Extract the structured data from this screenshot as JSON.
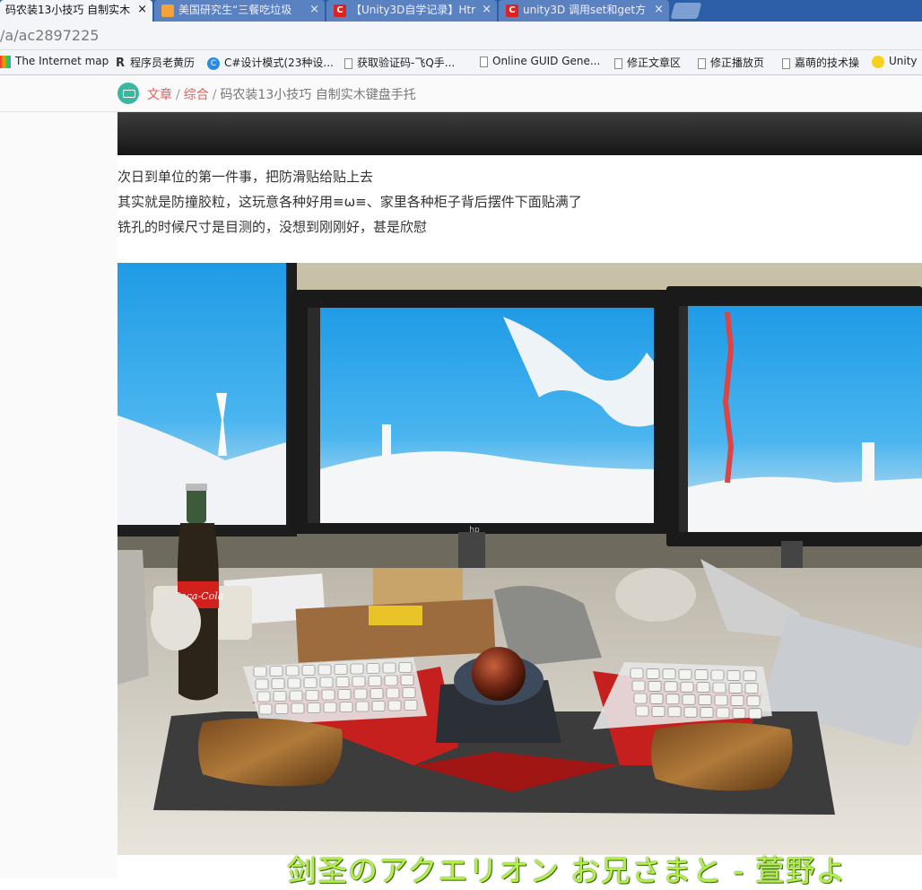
{
  "tabs": [
    {
      "title": "码农装13小技巧 自制实木",
      "active": true,
      "favicon": "red",
      "icon_char": ""
    },
    {
      "title": "美国研究生“三餐吃垃圾",
      "active": false,
      "favicon": "pic",
      "icon_char": ""
    },
    {
      "title": "【Unity3D自学记录】Htr",
      "active": false,
      "favicon": "red",
      "icon_char": "C"
    },
    {
      "title": "unity3D 调用set和get方",
      "active": false,
      "favicon": "red",
      "icon_char": "C"
    }
  ],
  "close_glyph": "×",
  "address": {
    "url": "/a/ac2897225"
  },
  "bookmarks": [
    {
      "label": "The Internet map",
      "icon": "map"
    },
    {
      "label": "程序员老黄历",
      "icon": "logo"
    },
    {
      "label": "C#设计模式(23种设...",
      "icon": "cs"
    },
    {
      "label": "获取验证码-飞Q手...",
      "icon": "page"
    },
    {
      "label": "Online GUID Gene...",
      "icon": "page"
    },
    {
      "label": "修正文章区",
      "icon": "page"
    },
    {
      "label": "修正播放页",
      "icon": "page"
    },
    {
      "label": "嘉萌的技术操",
      "icon": "page"
    },
    {
      "label": "Unity",
      "icon": "unity"
    }
  ],
  "breadcrumb": {
    "root": "文章",
    "category": "综合",
    "current": "码农装13小技巧 自制实木键盘手托",
    "sep": "/"
  },
  "article": {
    "paragraphs": [
      "次日到单位的第一件事，把防滑贴给贴上去",
      "其实就是防撞胶粒，这玩意各种好用≡ω≡、家里各种柜子背后摆件下面贴满了",
      "铣孔的时候尺寸是目测的，没想到刚刚好，甚是欣慰"
    ],
    "photo_overlay_text": "剑圣のアクエリオン お兄さまと - 萱野よ",
    "bottle_label": "Coca-Cola"
  },
  "colors": {
    "tab_bar": "#2d5ea8",
    "link": "#e06060",
    "subtitle": "#b4f043"
  }
}
